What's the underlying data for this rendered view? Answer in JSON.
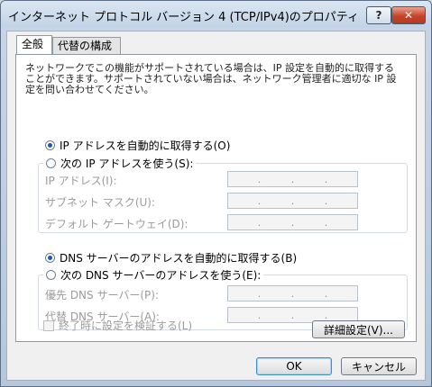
{
  "window": {
    "title": "インターネット プロトコル バージョン 4 (TCP/IPv4)のプロパティ",
    "help_label": "?",
    "close_label": "✕"
  },
  "tabs": [
    {
      "label": "全般"
    },
    {
      "label": "代替の構成"
    }
  ],
  "general": {
    "description": "ネットワークでこの機能がサポートされている場合は、IP 設定を自動的に取得することができます。サポートされていない場合は、ネットワーク管理者に適切な IP 設定を問い合わせてください。",
    "ip_auto_label": "IP アドレスを自動的に取得する(O)",
    "ip_manual_label": "次の IP アドレスを使う(S):",
    "ip_address_label": "IP アドレス(I):",
    "subnet_label": "サブネット マスク(U):",
    "gateway_label": "デフォルト ゲートウェイ(D):",
    "dns_auto_label": "DNS サーバーのアドレスを自動的に取得する(B)",
    "dns_manual_label": "次の DNS サーバーのアドレスを使う(E):",
    "preferred_dns_label": "優先 DNS サーバー(P):",
    "alternate_dns_label": "代替 DNS サーバー(A):",
    "ip_separator": "."
  },
  "validate_label": "終了時に設定を検証する(L)",
  "advanced_label": "詳細設定(V)...",
  "ok_label": "OK",
  "cancel_label": "キャンセル"
}
